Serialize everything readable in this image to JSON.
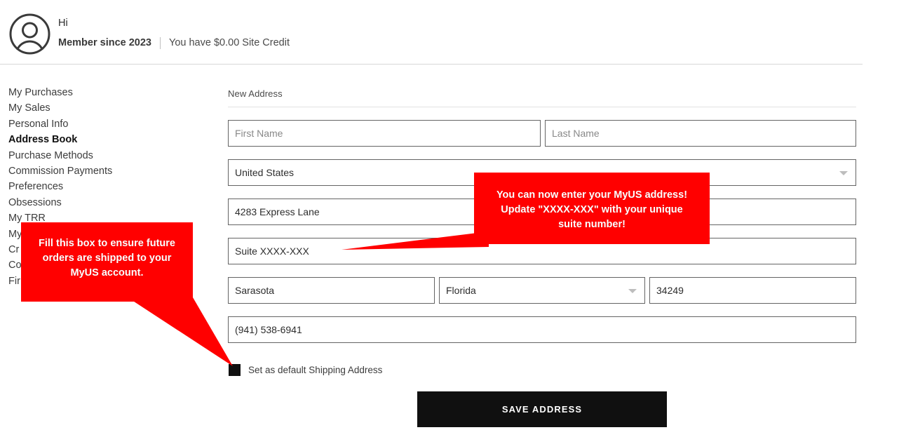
{
  "header": {
    "avatar_icon": "user-avatar-icon",
    "greeting": "Hi",
    "member_since": "Member since 2023",
    "site_credit": "You have $0.00 Site Credit"
  },
  "sidebar": {
    "items": [
      {
        "label": "My Purchases",
        "active": false
      },
      {
        "label": "My Sales",
        "active": false
      },
      {
        "label": "Personal Info",
        "active": false
      },
      {
        "label": "Address Book",
        "active": true
      },
      {
        "label": "Purchase Methods",
        "active": false
      },
      {
        "label": "Commission Payments",
        "active": false
      },
      {
        "label": "Preferences",
        "active": false
      },
      {
        "label": "Obsessions",
        "active": false
      },
      {
        "label": "My TRR",
        "active": false
      },
      {
        "label": "My",
        "active": false
      },
      {
        "label": "Cr",
        "active": false
      },
      {
        "label": "Co",
        "active": false
      },
      {
        "label": "Fir",
        "active": false
      }
    ]
  },
  "form": {
    "title": "New Address",
    "first_name": {
      "value": "",
      "placeholder": "First Name"
    },
    "last_name": {
      "value": "",
      "placeholder": "Last Name"
    },
    "country": {
      "value": "United States",
      "caret_icon": "chevron-down-icon"
    },
    "street": {
      "value": "4283 Express Lane"
    },
    "suite": {
      "value": "Suite XXXX-XXX"
    },
    "city": {
      "value": "Sarasota"
    },
    "state": {
      "value": "Florida",
      "caret_icon": "chevron-down-icon"
    },
    "zip": {
      "value": "34249"
    },
    "phone": {
      "value": "(941) 538-6941"
    },
    "default_shipping_label": "Set as default Shipping Address",
    "save_label": "SAVE ADDRESS"
  },
  "annotations": {
    "accent_color": "#FF0000",
    "left_callout": {
      "line1": "Fill this box to ensure future",
      "line2": "orders are shipped to your",
      "line3": "MyUS account."
    },
    "right_callout": {
      "line1": "You can now enter your MyUS address!",
      "line2": "Update \"XXXX-XXX\" with your unique",
      "line3": "suite number!"
    }
  }
}
